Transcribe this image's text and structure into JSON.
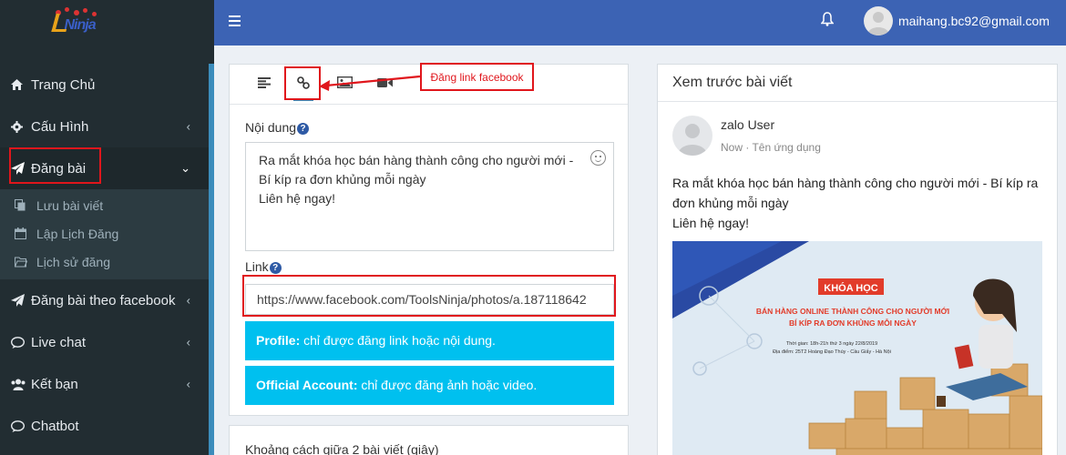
{
  "sidebar": {
    "menu": [
      {
        "label": "Trang Chủ",
        "icon": "home-icon",
        "has_caret": false
      },
      {
        "label": "Cấu Hình",
        "icon": "gear-icon",
        "has_caret": true
      },
      {
        "label": "Đăng bài",
        "icon": "paper-plane-icon",
        "has_caret": true,
        "active": true
      }
    ],
    "submenu": [
      {
        "label": "Lưu bài viết",
        "icon": "copy-icon"
      },
      {
        "label": "Lập Lịch Đăng",
        "icon": "calendar-icon"
      },
      {
        "label": "Lịch sử đăng",
        "icon": "folder-icon"
      }
    ],
    "menu2": [
      {
        "label": "Đăng bài theo facebook",
        "icon": "paper-plane-icon"
      },
      {
        "label": "Live chat",
        "icon": "chat-icon"
      },
      {
        "label": "Kết bạn",
        "icon": "users-icon"
      },
      {
        "label": "Chatbot",
        "icon": "chat-icon"
      }
    ]
  },
  "topbar": {
    "email": "maihang.bc92@gmail.com"
  },
  "editor": {
    "content_label": "Nội dung",
    "content_lines": [
      "Ra mắt khóa học bán hàng thành công cho người mới -",
      "Bí kíp ra đơn khủng mỗi ngày",
      "Liên hệ ngay!"
    ],
    "link_label": "Link",
    "link_value": "https://www.facebook.com/ToolsNinja/photos/a.187118642",
    "profile_strong": "Profile:",
    "profile_text": " chỉ được đăng link hoặc nội dung.",
    "official_strong": "Official Account:",
    "official_text": " chỉ được đăng ảnh hoặc video."
  },
  "panel2": {
    "label": "Khoảng cách giữa 2 bài viết (giây)"
  },
  "annotation": {
    "label": "Đăng link facebook"
  },
  "preview": {
    "title": "Xem trước bài viết",
    "user_name": "zalo User",
    "meta": "Now · Tên ứng dụng",
    "text_lines": [
      "Ra mắt khóa học bán hàng thành công cho người mới - Bí kíp ra đơn khủng mỗi ngày",
      "Liên hệ ngay!"
    ],
    "image": {
      "banner": "KHÓA HỌC",
      "headline1": "BÁN HÀNG ONLINE THÀNH CÔNG CHO NGƯỜI MỚI",
      "headline2": "BÍ KÍP RA ĐƠN KHỦNG MỖI NGÀY",
      "time": "Thời gian: 18h-21h thứ 3 ngày 22/8/2019",
      "place": "Địa điểm: 25T2 Hoàng Đạo Thúy - Cầu Giấy - Hà Nội"
    }
  },
  "colors": {
    "topbar": "#3c63b4",
    "sidebar": "#222d32",
    "info": "#00c0ef",
    "annotation": "#e0161c"
  }
}
